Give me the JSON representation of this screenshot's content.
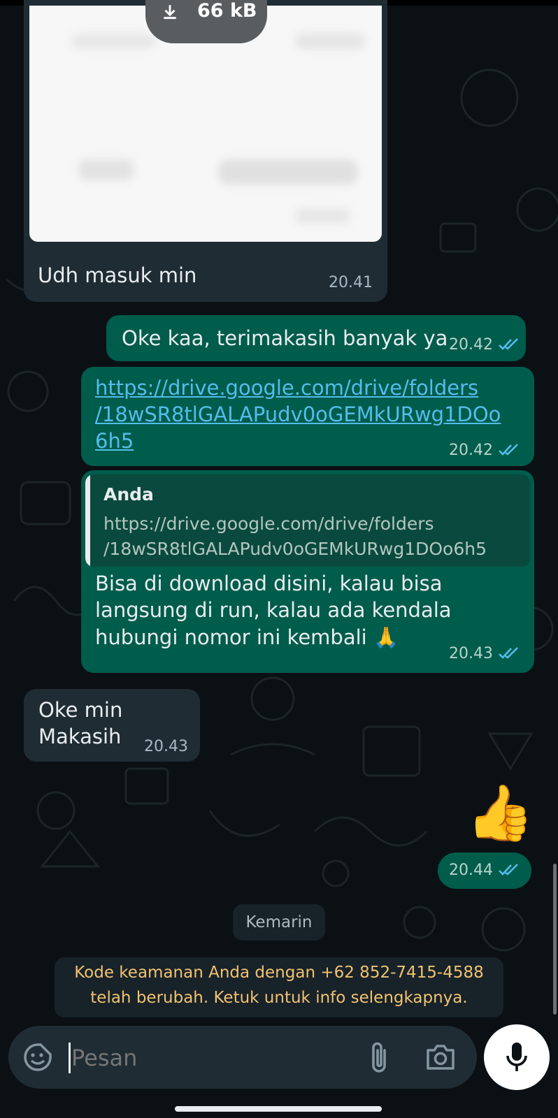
{
  "conversation": {
    "image_message": {
      "download_size": "66 kB",
      "caption": "Udh masuk min",
      "time": "20.41"
    },
    "out1": {
      "text": "Oke kaa, terimakasih banyak ya",
      "time": "20.42"
    },
    "out2": {
      "link_lines": [
        "https://drive.google.com/drive/folders",
        "/18wSR8tlGALAPudv0oGEMkURwg1DOo",
        "6h5"
      ],
      "time": "20.42"
    },
    "out3": {
      "quote_author": "Anda",
      "quote_lines": [
        "https://drive.google.com/drive/folders",
        "/18wSR8tlGALAPudv0oGEMkURwg1DOo6h5"
      ],
      "text_lines": [
        "Bisa di download disini, kalau bisa",
        "langsung di run, kalau ada kendala",
        "hubungi nomor ini kembali 🙏"
      ],
      "time": "20.43"
    },
    "in2": {
      "text_lines": [
        "Oke min",
        "Makasih"
      ],
      "time": "20.43"
    },
    "thumbs": {
      "emoji": "👍",
      "time": "20.44"
    },
    "date_chip": "Kemarin",
    "security_notice": {
      "lines": [
        "Kode keamanan Anda dengan +62 852-7415-4588",
        "telah berubah. Ketuk untuk info selengkapnya."
      ]
    }
  },
  "composer": {
    "placeholder": "Pesan"
  },
  "colors": {
    "background": "#0b1014",
    "incoming_bubble": "#1f2c34",
    "outgoing_bubble": "#005c4b",
    "link": "#53bdeb",
    "read_ticks": "#53bdeb",
    "notice_text": "#f0c371"
  },
  "icons": {
    "download": "download-icon",
    "read_receipt": "double-check-icon",
    "sticker": "sticker-icon",
    "attach": "paperclip-icon",
    "camera": "camera-icon",
    "mic": "mic-icon"
  }
}
